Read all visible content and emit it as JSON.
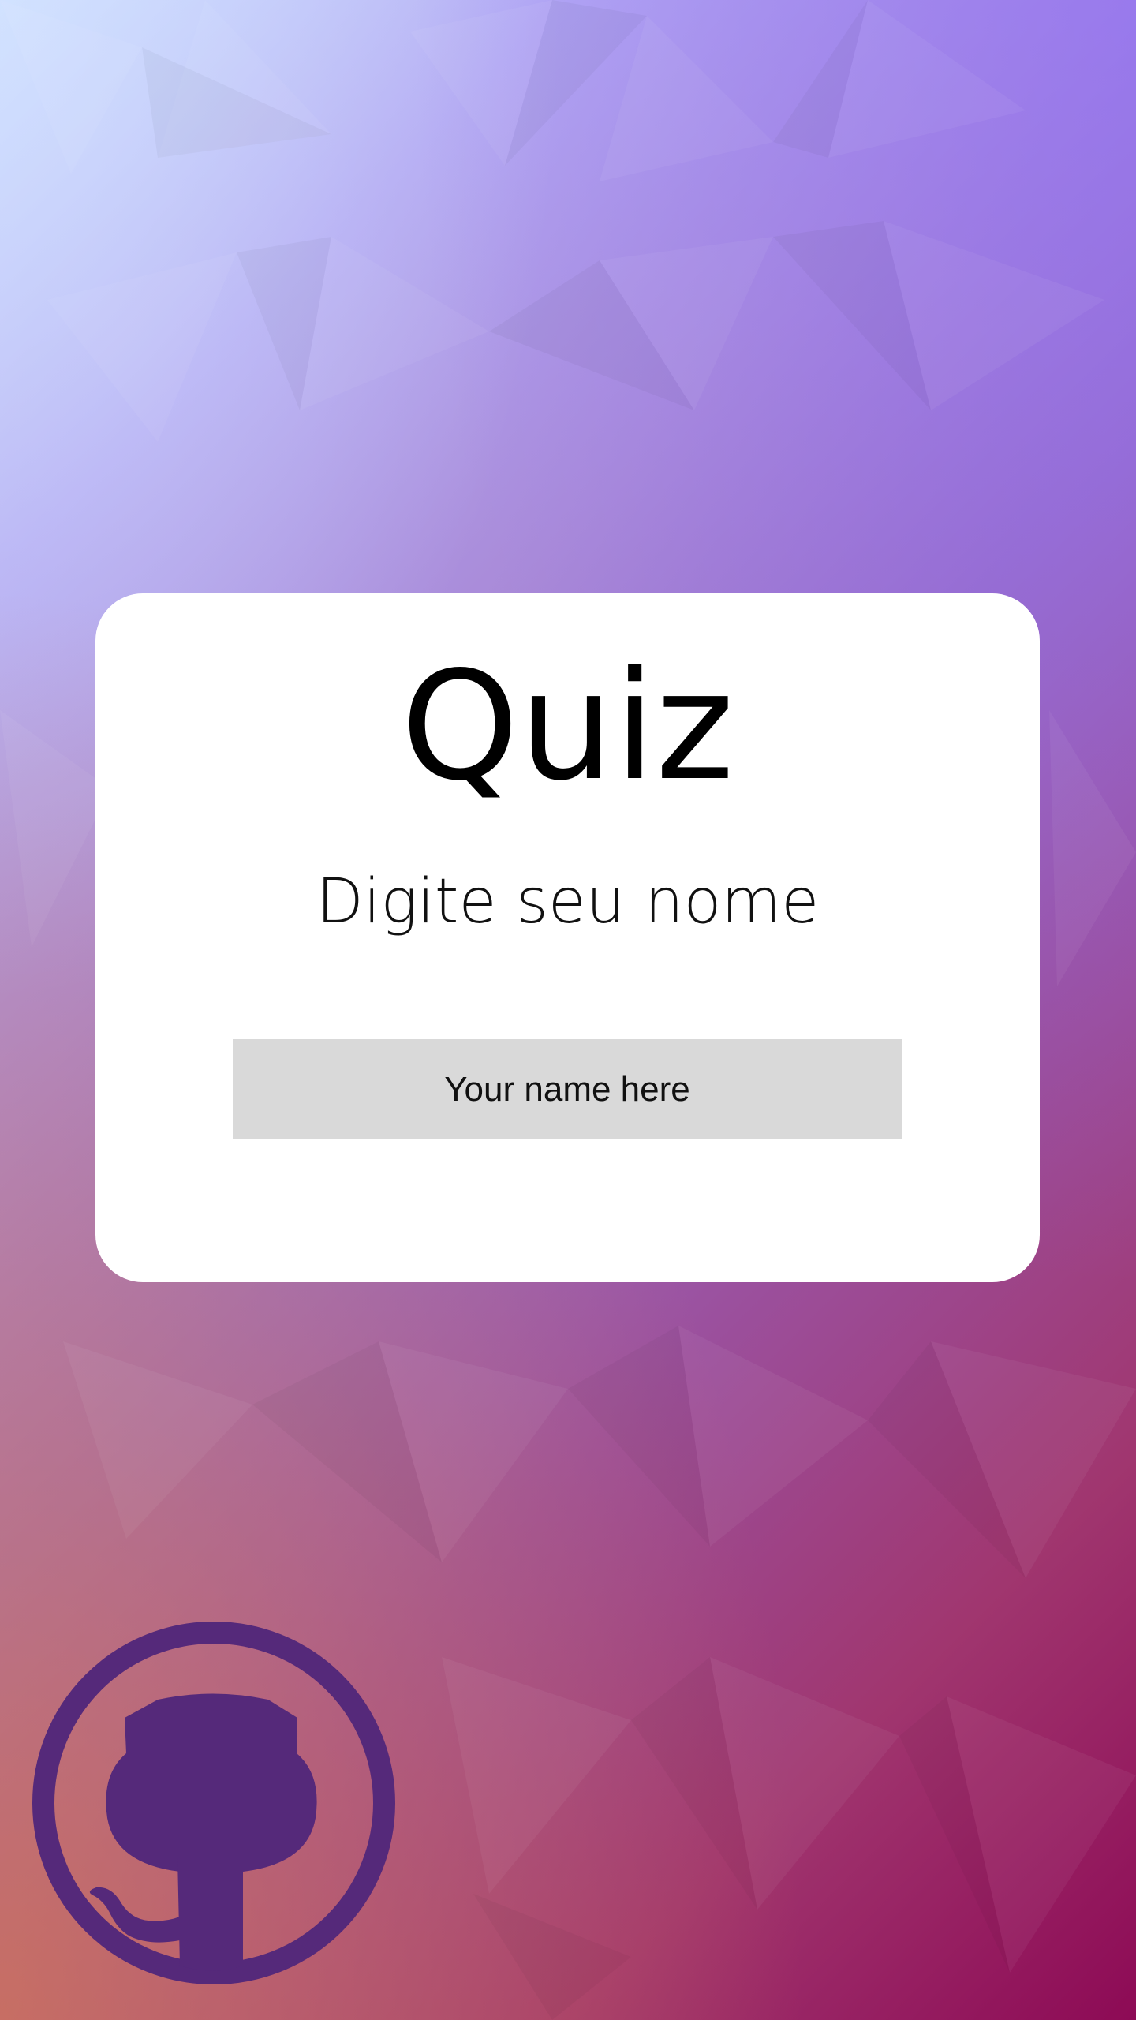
{
  "app": {
    "title": "Quiz",
    "subtitle": "Digite seu nome"
  },
  "form": {
    "name_placeholder": "Your name here",
    "name_value": ""
  },
  "footer": {
    "github_icon": "github-octocat-icon",
    "github_color": "#55297a"
  },
  "theme": {
    "card_background": "#ffffff",
    "input_background": "#d9d9d9",
    "gradient_start": "#c9dcff",
    "gradient_end": "#8d0a55"
  }
}
